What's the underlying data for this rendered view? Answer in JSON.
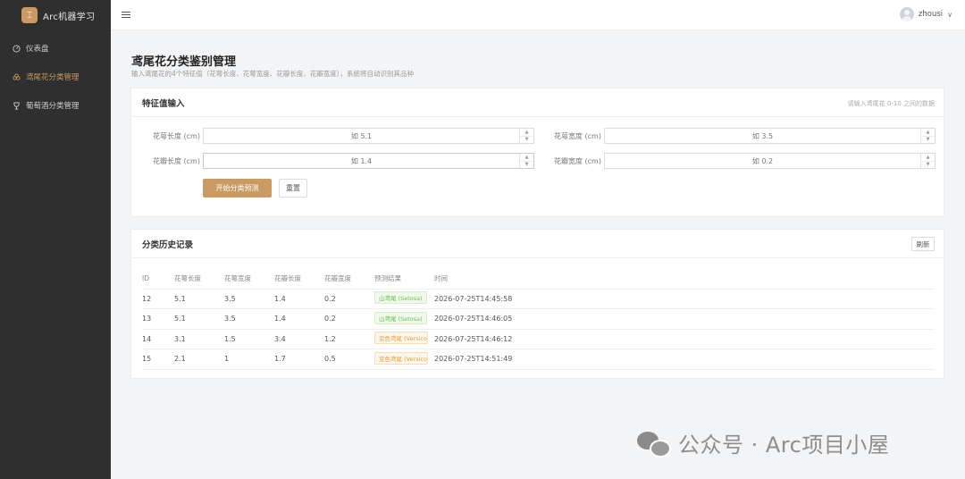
{
  "brand": {
    "title": "Arc机器学习",
    "logo_glyph": "⌶"
  },
  "sidebar": {
    "items": [
      {
        "label": "仪表盘",
        "icon": "dashboard-icon",
        "active": false
      },
      {
        "label": "鸢尾花分类管理",
        "icon": "flower-icon",
        "active": true
      },
      {
        "label": "葡萄酒分类管理",
        "icon": "wine-icon",
        "active": false
      }
    ]
  },
  "header": {
    "user_name": "zhousi",
    "chevron": "∨"
  },
  "page": {
    "title": "鸢尾花分类鉴别管理",
    "subtitle": "输入鸢尾花的4个特征值（花萼长度、花萼宽度、花瓣长度、花瓣宽度），系统将自动识别其品种"
  },
  "form": {
    "title": "特征值输入",
    "hint": "请输入鸢尾花 0-10 之间的数据",
    "fields": [
      {
        "label": "花萼长度 (cm)",
        "placeholder": "如 5.1"
      },
      {
        "label": "花萼宽度 (cm)",
        "placeholder": "如 3.5"
      },
      {
        "label": "花瓣长度 (cm)",
        "placeholder": "如 1.4"
      },
      {
        "label": "花瓣宽度 (cm)",
        "placeholder": "如 0.2"
      }
    ],
    "submit_label": "开始分类预测",
    "reset_label": "重置"
  },
  "history": {
    "title": "分类历史记录",
    "refresh_label": "刷新",
    "columns": [
      "ID",
      "花萼长度",
      "花萼宽度",
      "花瓣长度",
      "花瓣宽度",
      "预测结果",
      "时间"
    ],
    "rows": [
      {
        "id": "12",
        "sl": "5.1",
        "sw": "3.5",
        "pl": "1.4",
        "pw": "0.2",
        "result": "山鸢尾 (Setosa)",
        "type": "setosa",
        "time": "2026-07-25T14:45:58"
      },
      {
        "id": "13",
        "sl": "5.1",
        "sw": "3.5",
        "pl": "1.4",
        "pw": "0.2",
        "result": "山鸢尾 (Setosa)",
        "type": "setosa",
        "time": "2026-07-25T14:46:05"
      },
      {
        "id": "14",
        "sl": "3.1",
        "sw": "1.5",
        "pl": "3.4",
        "pw": "1.2",
        "result": "变色鸢尾 (Versicolor)",
        "type": "versicolor",
        "time": "2026-07-25T14:46:12"
      },
      {
        "id": "15",
        "sl": "2.1",
        "sw": "1",
        "pl": "1.7",
        "pw": "0.5",
        "result": "变色鸢尾 (Versicolor)",
        "type": "versicolor",
        "time": "2026-07-25T14:51:49"
      }
    ]
  },
  "watermark": {
    "text": "公众号 · Arc项目小屋",
    "icon": "wechat-icon"
  },
  "colors": {
    "accent": "#c99a63",
    "sidebar_bg": "#2f2f30",
    "setosa": "#6bbd53",
    "versicolor": "#e2a23c"
  }
}
